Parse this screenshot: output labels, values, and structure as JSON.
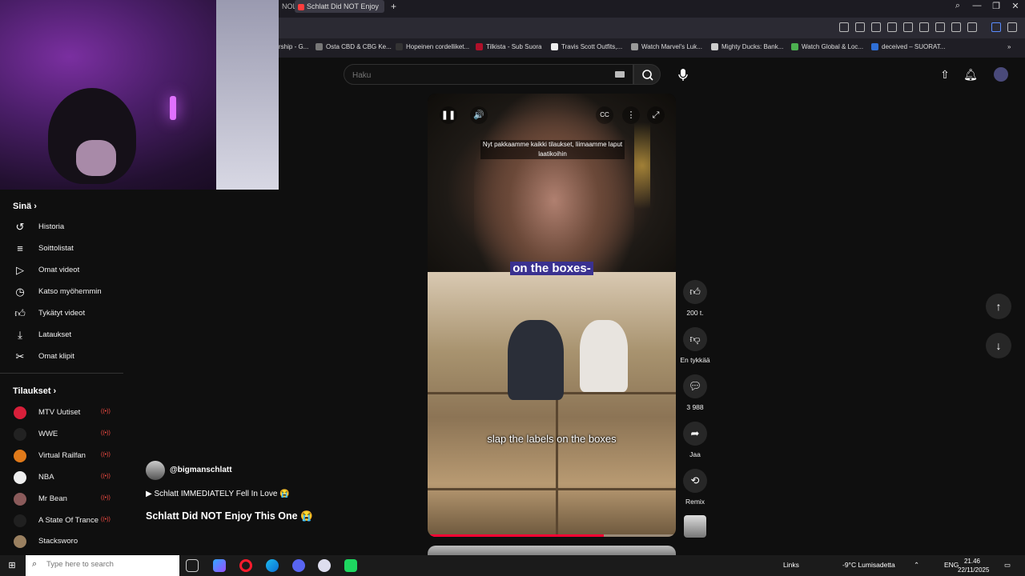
{
  "browser": {
    "tabs": [
      {
        "label": "NOL"
      },
      {
        "label": "Schlatt Did NOT Enjoy"
      }
    ],
    "new_tab": "+",
    "window_controls": [
      "⌕",
      "—",
      "❐",
      "✕"
    ],
    "bookmarks": [
      {
        "label": "rship - G..."
      },
      {
        "label": "Osta CBD & CBG Ke..."
      },
      {
        "label": "Hopeinen cordelliket..."
      },
      {
        "label": "Tilkista - Sub Suora"
      },
      {
        "label": "Travis Scott Outfits,..."
      },
      {
        "label": "Watch Marvel's Luk..."
      },
      {
        "label": "Mighty Ducks: Bank..."
      },
      {
        "label": "Watch Global & Loc..."
      },
      {
        "label": "deceived – SUORAT..."
      }
    ]
  },
  "search": {
    "placeholder": "Haku"
  },
  "sidebar": {
    "you_title": "Sinä",
    "you_items": [
      {
        "label": "Historia",
        "icon": "history-icon"
      },
      {
        "label": "Soittolistat",
        "icon": "playlists-icon"
      },
      {
        "label": "Omat videot",
        "icon": "your-videos-icon"
      },
      {
        "label": "Katso myöhemmin",
        "icon": "watch-later-icon"
      },
      {
        "label": "Tykätyt videot",
        "icon": "liked-icon"
      },
      {
        "label": "Lataukset",
        "icon": "downloads-icon"
      },
      {
        "label": "Omat klipit",
        "icon": "clips-icon"
      }
    ],
    "subs_title": "Tilaukset",
    "subs": [
      {
        "label": "MTV Uutiset",
        "color": "#d81f3a"
      },
      {
        "label": "WWE",
        "color": "#222222"
      },
      {
        "label": "Virtual Railfan",
        "color": "#e07a1a"
      },
      {
        "label": "NBA",
        "color": "#eeeeee"
      },
      {
        "label": "Mr Bean",
        "color": "#8a5a5a"
      },
      {
        "label": "A State Of Trance",
        "color": "#202020"
      },
      {
        "label": "Stacksworo",
        "color": "#9a8060"
      }
    ]
  },
  "short": {
    "caption_top": "Nyt pakkaamme kaikki tilaukset, liimaamme laput laatikoihin",
    "caption_big": "on the boxes-",
    "caption_bottom": "slap the labels on the boxes",
    "progress": 0.71,
    "controls": {
      "play": "❚❚",
      "volume": "🔊",
      "cc": "CC",
      "more": "⋮",
      "fullscreen": "⤢"
    }
  },
  "actions": {
    "like_count": "200 t.",
    "dislike_label": "En tykkää",
    "comment_count": "3 988",
    "share_label": "Jaa",
    "remix_label": "Remix"
  },
  "video": {
    "channel": "@bigmanschlatt",
    "playlist": "▶ Schlatt IMMEDIATELY Fell In Love 😭",
    "title": "Schlatt Did NOT Enjoy This One 😭"
  },
  "taskbar": {
    "search_placeholder": "Type here to search",
    "links": "Links",
    "weather": "-9°C  Lumisadetta",
    "lang": "ENG",
    "time": "21.46",
    "date": "22/11/2025"
  }
}
